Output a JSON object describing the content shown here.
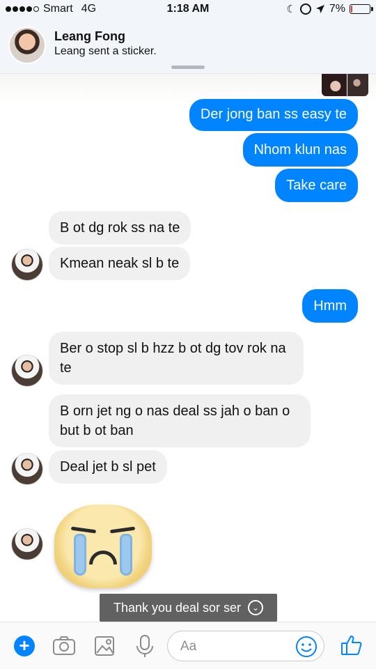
{
  "status_bar": {
    "carrier": "Smart",
    "network": "4G",
    "time": "1:18 AM",
    "battery": "7%",
    "battery_fraction": 0.07
  },
  "notification": {
    "title": "Leang Fong",
    "message": "Leang sent a sticker."
  },
  "conversation": {
    "messages": [
      {
        "side": "sent",
        "text": "Der jong ban ss easy te"
      },
      {
        "side": "sent",
        "text": "Nhom klun nas"
      },
      {
        "side": "sent",
        "text": "Take care"
      },
      {
        "side": "received",
        "text": "B ot dg rok ss na te"
      },
      {
        "side": "received",
        "text": "Kmean neak sl b te"
      },
      {
        "side": "sent",
        "text": "Hmm"
      },
      {
        "side": "received",
        "text": "Ber o stop sl b hzz b ot dg tov rok na te"
      },
      {
        "side": "received",
        "text": "B orn jet ng o nas deal ss jah o ban o but b ot ban"
      },
      {
        "side": "received",
        "text": "Deal jet b sl pet"
      }
    ],
    "sticker": "crying-face-sticker"
  },
  "toast": {
    "text": "Thank you deal sor ser",
    "icon": "chevron-down-circle-icon"
  },
  "composer": {
    "placeholder": "Aa",
    "icons": [
      "plus-icon",
      "camera-icon",
      "image-icon",
      "microphone-icon",
      "smiley-icon",
      "thumbs-up-icon"
    ],
    "accent_color": "#0084ff"
  },
  "colors": {
    "sent_bubble": "#0084ff",
    "received_bubble": "#f1f0f0",
    "battery_low": "#e53935"
  }
}
